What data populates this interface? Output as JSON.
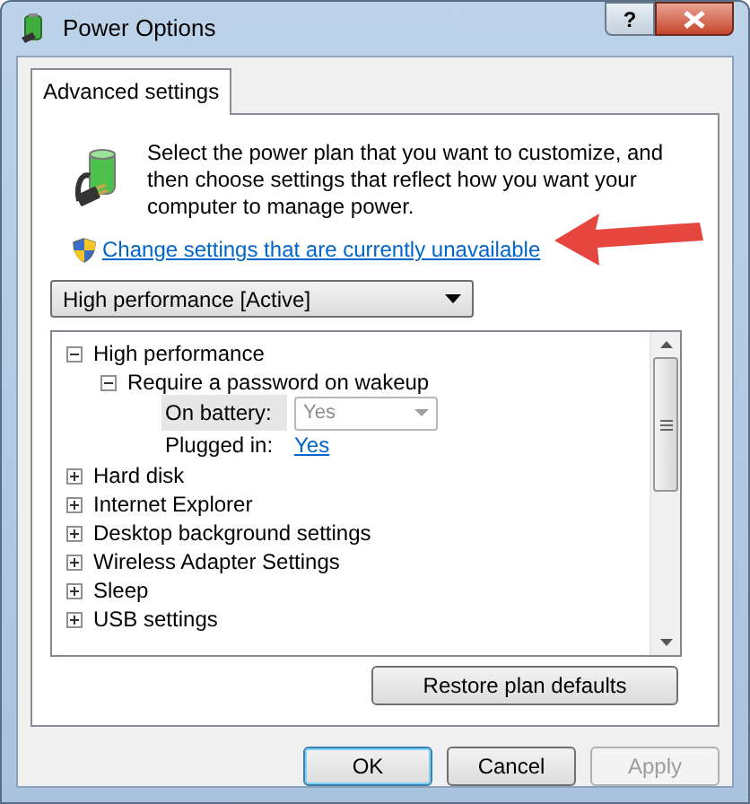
{
  "window": {
    "title": "Power Options",
    "help": "?"
  },
  "tabs": [
    {
      "label": "Advanced settings",
      "selected": true
    }
  ],
  "intro": "Select the power plan that you want to customize, and then choose settings that reflect how you want your computer to manage power.",
  "link": "Change settings that are currently unavailable",
  "plan_select": {
    "value": "High performance [Active]"
  },
  "tree": [
    {
      "label": "High performance",
      "expanded": true,
      "children": [
        {
          "label": "Require a password on wakeup",
          "expanded": true,
          "settings": [
            {
              "kind": "combo",
              "label": "On battery:",
              "value": "Yes",
              "disabled": true,
              "selected": true
            },
            {
              "kind": "link",
              "label": "Plugged in:",
              "value": "Yes",
              "selected": false
            }
          ]
        }
      ]
    },
    {
      "label": "Hard disk",
      "expanded": false
    },
    {
      "label": "Internet Explorer",
      "expanded": false
    },
    {
      "label": "Desktop background settings",
      "expanded": false
    },
    {
      "label": "Wireless Adapter Settings",
      "expanded": false
    },
    {
      "label": "Sleep",
      "expanded": false
    },
    {
      "label": "USB settings",
      "expanded": false
    }
  ],
  "restore_button": "Restore plan defaults",
  "buttons": [
    {
      "label": "OK",
      "default": true,
      "disabled": false
    },
    {
      "label": "Cancel",
      "default": false,
      "disabled": false
    },
    {
      "label": "Apply",
      "default": false,
      "disabled": true
    }
  ]
}
